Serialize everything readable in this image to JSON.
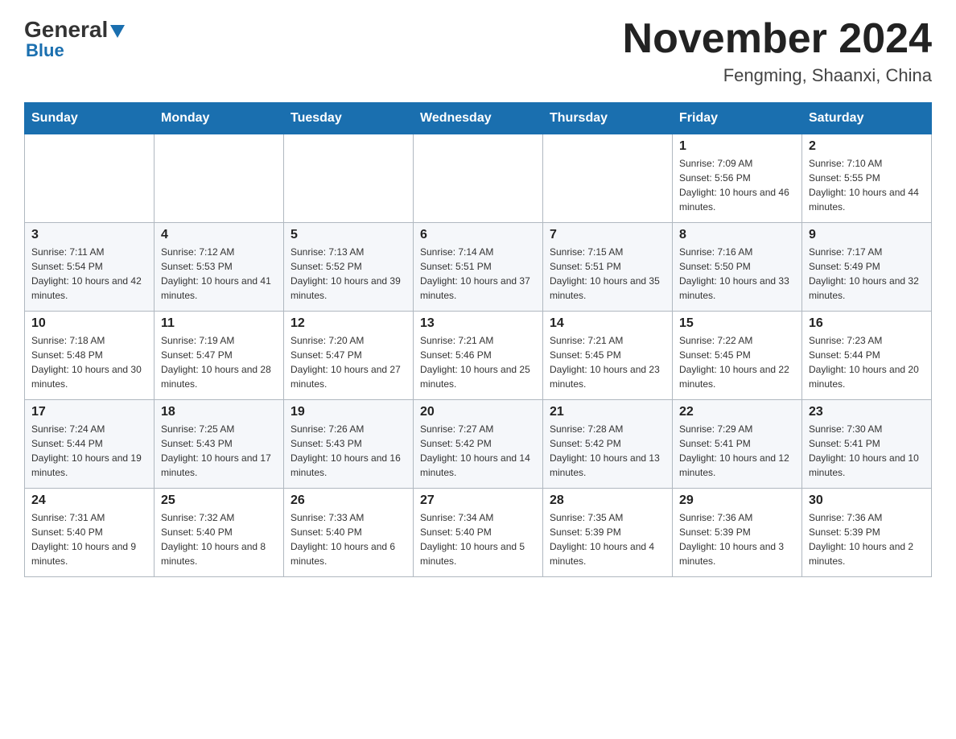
{
  "header": {
    "logo": {
      "general": "General",
      "blue": "Blue"
    },
    "title": "November 2024",
    "location": "Fengming, Shaanxi, China"
  },
  "days_of_week": [
    "Sunday",
    "Monday",
    "Tuesday",
    "Wednesday",
    "Thursday",
    "Friday",
    "Saturday"
  ],
  "weeks": [
    [
      {
        "day": "",
        "info": ""
      },
      {
        "day": "",
        "info": ""
      },
      {
        "day": "",
        "info": ""
      },
      {
        "day": "",
        "info": ""
      },
      {
        "day": "",
        "info": ""
      },
      {
        "day": "1",
        "info": "Sunrise: 7:09 AM\nSunset: 5:56 PM\nDaylight: 10 hours and 46 minutes."
      },
      {
        "day": "2",
        "info": "Sunrise: 7:10 AM\nSunset: 5:55 PM\nDaylight: 10 hours and 44 minutes."
      }
    ],
    [
      {
        "day": "3",
        "info": "Sunrise: 7:11 AM\nSunset: 5:54 PM\nDaylight: 10 hours and 42 minutes."
      },
      {
        "day": "4",
        "info": "Sunrise: 7:12 AM\nSunset: 5:53 PM\nDaylight: 10 hours and 41 minutes."
      },
      {
        "day": "5",
        "info": "Sunrise: 7:13 AM\nSunset: 5:52 PM\nDaylight: 10 hours and 39 minutes."
      },
      {
        "day": "6",
        "info": "Sunrise: 7:14 AM\nSunset: 5:51 PM\nDaylight: 10 hours and 37 minutes."
      },
      {
        "day": "7",
        "info": "Sunrise: 7:15 AM\nSunset: 5:51 PM\nDaylight: 10 hours and 35 minutes."
      },
      {
        "day": "8",
        "info": "Sunrise: 7:16 AM\nSunset: 5:50 PM\nDaylight: 10 hours and 33 minutes."
      },
      {
        "day": "9",
        "info": "Sunrise: 7:17 AM\nSunset: 5:49 PM\nDaylight: 10 hours and 32 minutes."
      }
    ],
    [
      {
        "day": "10",
        "info": "Sunrise: 7:18 AM\nSunset: 5:48 PM\nDaylight: 10 hours and 30 minutes."
      },
      {
        "day": "11",
        "info": "Sunrise: 7:19 AM\nSunset: 5:47 PM\nDaylight: 10 hours and 28 minutes."
      },
      {
        "day": "12",
        "info": "Sunrise: 7:20 AM\nSunset: 5:47 PM\nDaylight: 10 hours and 27 minutes."
      },
      {
        "day": "13",
        "info": "Sunrise: 7:21 AM\nSunset: 5:46 PM\nDaylight: 10 hours and 25 minutes."
      },
      {
        "day": "14",
        "info": "Sunrise: 7:21 AM\nSunset: 5:45 PM\nDaylight: 10 hours and 23 minutes."
      },
      {
        "day": "15",
        "info": "Sunrise: 7:22 AM\nSunset: 5:45 PM\nDaylight: 10 hours and 22 minutes."
      },
      {
        "day": "16",
        "info": "Sunrise: 7:23 AM\nSunset: 5:44 PM\nDaylight: 10 hours and 20 minutes."
      }
    ],
    [
      {
        "day": "17",
        "info": "Sunrise: 7:24 AM\nSunset: 5:44 PM\nDaylight: 10 hours and 19 minutes."
      },
      {
        "day": "18",
        "info": "Sunrise: 7:25 AM\nSunset: 5:43 PM\nDaylight: 10 hours and 17 minutes."
      },
      {
        "day": "19",
        "info": "Sunrise: 7:26 AM\nSunset: 5:43 PM\nDaylight: 10 hours and 16 minutes."
      },
      {
        "day": "20",
        "info": "Sunrise: 7:27 AM\nSunset: 5:42 PM\nDaylight: 10 hours and 14 minutes."
      },
      {
        "day": "21",
        "info": "Sunrise: 7:28 AM\nSunset: 5:42 PM\nDaylight: 10 hours and 13 minutes."
      },
      {
        "day": "22",
        "info": "Sunrise: 7:29 AM\nSunset: 5:41 PM\nDaylight: 10 hours and 12 minutes."
      },
      {
        "day": "23",
        "info": "Sunrise: 7:30 AM\nSunset: 5:41 PM\nDaylight: 10 hours and 10 minutes."
      }
    ],
    [
      {
        "day": "24",
        "info": "Sunrise: 7:31 AM\nSunset: 5:40 PM\nDaylight: 10 hours and 9 minutes."
      },
      {
        "day": "25",
        "info": "Sunrise: 7:32 AM\nSunset: 5:40 PM\nDaylight: 10 hours and 8 minutes."
      },
      {
        "day": "26",
        "info": "Sunrise: 7:33 AM\nSunset: 5:40 PM\nDaylight: 10 hours and 6 minutes."
      },
      {
        "day": "27",
        "info": "Sunrise: 7:34 AM\nSunset: 5:40 PM\nDaylight: 10 hours and 5 minutes."
      },
      {
        "day": "28",
        "info": "Sunrise: 7:35 AM\nSunset: 5:39 PM\nDaylight: 10 hours and 4 minutes."
      },
      {
        "day": "29",
        "info": "Sunrise: 7:36 AM\nSunset: 5:39 PM\nDaylight: 10 hours and 3 minutes."
      },
      {
        "day": "30",
        "info": "Sunrise: 7:36 AM\nSunset: 5:39 PM\nDaylight: 10 hours and 2 minutes."
      }
    ]
  ]
}
